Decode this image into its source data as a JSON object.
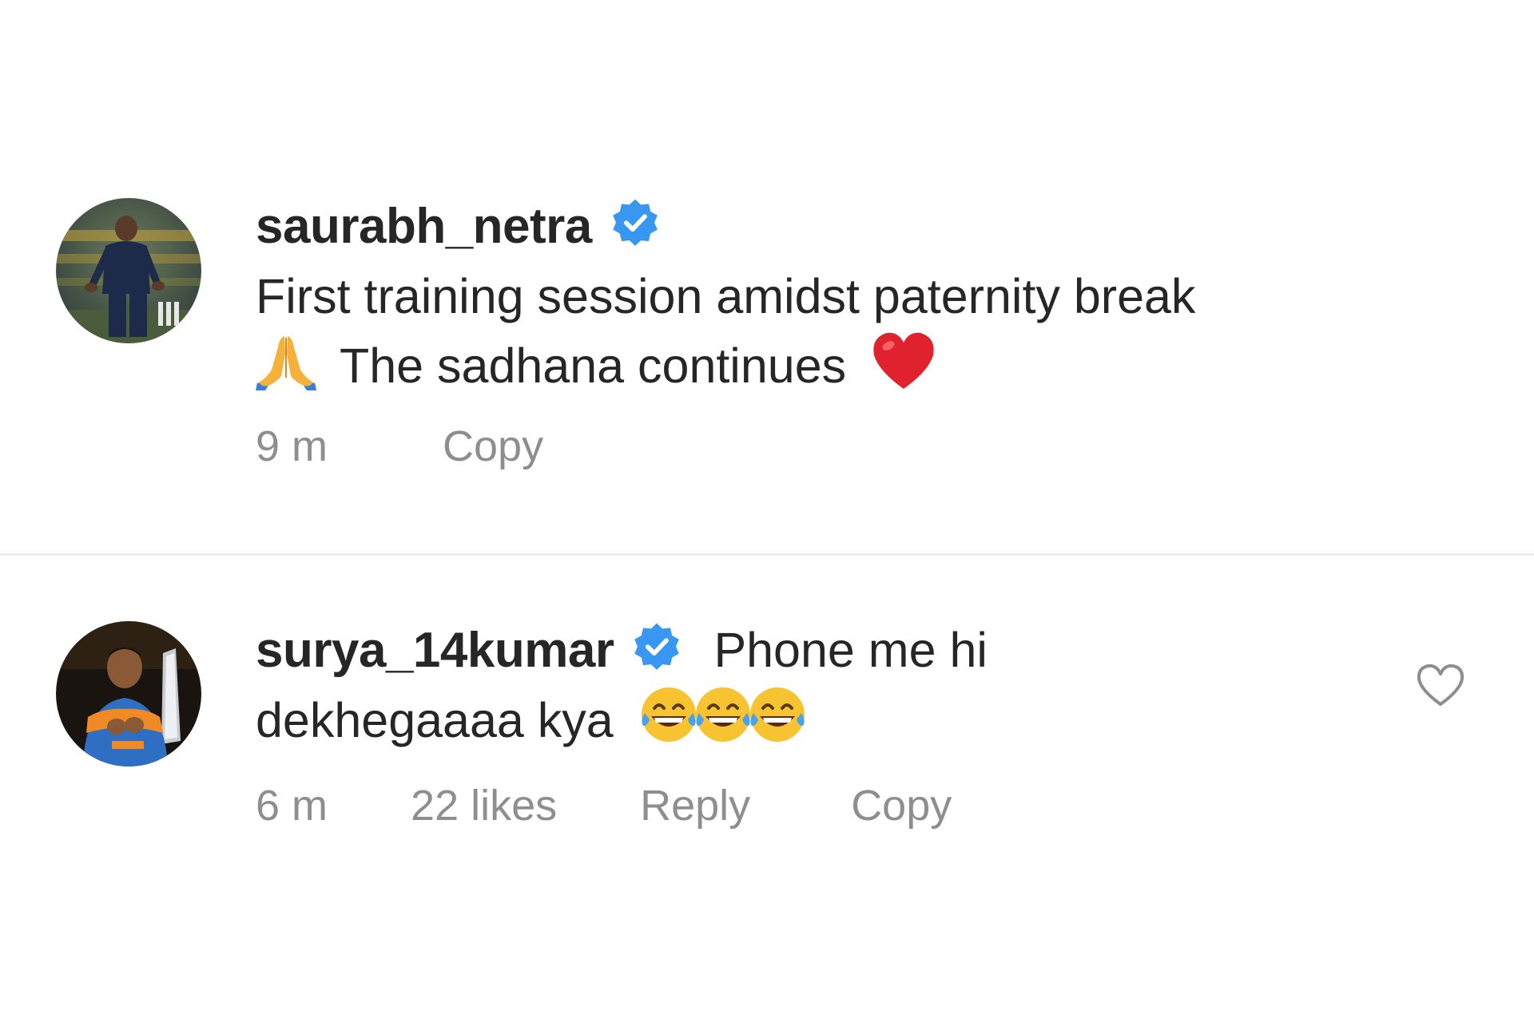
{
  "comments": [
    {
      "username": "saurabh_netra",
      "verified": true,
      "text_line1": "First training session amidst paternity break",
      "text_line2": "The sadhana continues",
      "emojis": [
        "folded-hands",
        "red-heart"
      ],
      "time": "9 m",
      "copy_label": "Copy"
    },
    {
      "username": "surya_14kumar",
      "verified": true,
      "text_line1": "Phone me hi",
      "text_line2": "dekhegaaaa kya",
      "emojis": [
        "tears-of-joy",
        "tears-of-joy",
        "tears-of-joy"
      ],
      "time": "6 m",
      "likes": "22 likes",
      "reply_label": "Reply",
      "copy_label": "Copy",
      "like_icon": "heart-outline-icon"
    }
  ],
  "colors": {
    "verified": "#3897f0",
    "text": "#262626",
    "meta": "#8e8e8e",
    "divider": "#ebebeb"
  }
}
